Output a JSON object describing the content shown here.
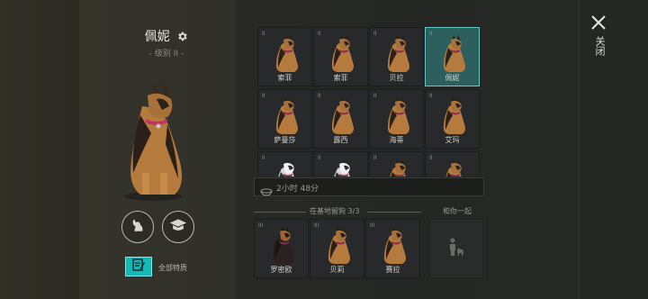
{
  "dog": {
    "name": "佩妮",
    "level": "- 级别 II -"
  },
  "buttons": {
    "traits_label": "全部特质"
  },
  "grid": {
    "rows": [
      [
        {
          "rank": "II",
          "name": "索菲",
          "selected": false,
          "breed": "shepherd"
        },
        {
          "rank": "II",
          "name": "索菲",
          "selected": false,
          "breed": "shepherd"
        },
        {
          "rank": "II",
          "name": "贝拉",
          "selected": false,
          "breed": "shepherd"
        },
        {
          "rank": "II",
          "name": "佩妮",
          "selected": true,
          "breed": "shepherd"
        }
      ],
      [
        {
          "rank": "II",
          "name": "萨曼莎",
          "selected": false,
          "breed": "shepherd"
        },
        {
          "rank": "II",
          "name": "露西",
          "selected": false,
          "breed": "shepherd"
        },
        {
          "rank": "II",
          "name": "海蒂",
          "selected": false,
          "breed": "shepherd"
        },
        {
          "rank": "II",
          "name": "艾玛",
          "selected": false,
          "breed": "shepherd"
        }
      ],
      [
        {
          "rank": "II",
          "name": "",
          "selected": false,
          "breed": "husky"
        },
        {
          "rank": "II",
          "name": "",
          "selected": false,
          "breed": "husky"
        },
        {
          "rank": "II",
          "name": "",
          "selected": false,
          "breed": "shepherd"
        },
        {
          "rank": "II",
          "name": "",
          "selected": false,
          "breed": "shepherd"
        }
      ]
    ]
  },
  "timer": {
    "text": "2小时 48分"
  },
  "base": {
    "header": "在基地留狗 3/3",
    "dogs": [
      {
        "rank": "III",
        "name": "罗密欧",
        "breed": "rottweiler"
      },
      {
        "rank": "III",
        "name": "贝莉",
        "breed": "shepherd"
      },
      {
        "rank": "III",
        "name": "赛拉",
        "breed": "shepherd"
      }
    ]
  },
  "companion": {
    "label": "和你一起"
  },
  "close": {
    "label": "关闭"
  }
}
